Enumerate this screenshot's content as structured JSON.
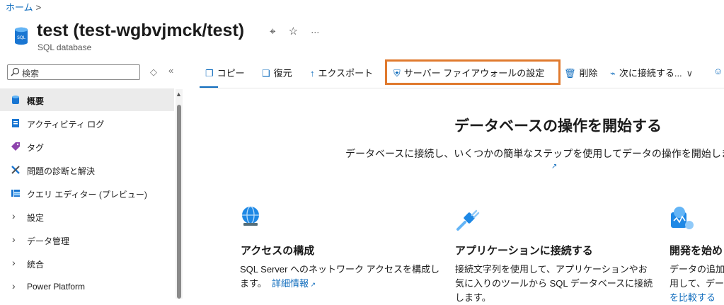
{
  "breadcrumb": {
    "home": "ホーム",
    "separator": ">"
  },
  "header": {
    "title": "test (test-wgbvjmck/test)",
    "subtitle": "SQL database",
    "pin_icon": "pin-icon",
    "star_icon": "star-icon",
    "more_icon": "more-icon"
  },
  "sidebar": {
    "search_placeholder": "検索",
    "items": [
      {
        "label": "概要",
        "icon": "sql-database-icon"
      },
      {
        "label": "アクティビティ ログ",
        "icon": "activity-log-icon"
      },
      {
        "label": "タグ",
        "icon": "tag-icon"
      },
      {
        "label": "問題の診断と解決",
        "icon": "wrench-icon"
      },
      {
        "label": "クエリ エディター (プレビュー)",
        "icon": "query-editor-icon"
      },
      {
        "label": "設定",
        "icon": "chevron-right-icon"
      },
      {
        "label": "データ管理",
        "icon": "chevron-right-icon"
      },
      {
        "label": "統合",
        "icon": "chevron-right-icon"
      },
      {
        "label": "Power Platform",
        "icon": "chevron-right-icon"
      }
    ]
  },
  "toolbar": {
    "copy": "コピー",
    "restore": "復元",
    "export": "エクスポート",
    "firewall": "サーバー ファイアウォールの設定",
    "delete": "削除",
    "connect": "次に接続する..."
  },
  "main": {
    "title": "データベースの操作を開始する",
    "description": "データベースに接続し、いくつかの簡単なステップを使用してデータの操作を開始します。",
    "cards": [
      {
        "title": "アクセスの構成",
        "line1": "SQL Server へのネットワーク アクセスを構成し",
        "line2": "ます。",
        "link": "詳細情報"
      },
      {
        "title": "アプリケーションに接続する",
        "line1": "接続文字列を使用して、アプリケーションやお",
        "line2": "気に入りのツールから SQL データベースに接続",
        "line3": "します。"
      },
      {
        "title": "開発を始め",
        "line1": "データの追加",
        "line2": "用して、デー",
        "line3": "を比較する"
      }
    ]
  },
  "colors": {
    "accent": "#0f6cbd",
    "highlight": "#e07a2e"
  }
}
